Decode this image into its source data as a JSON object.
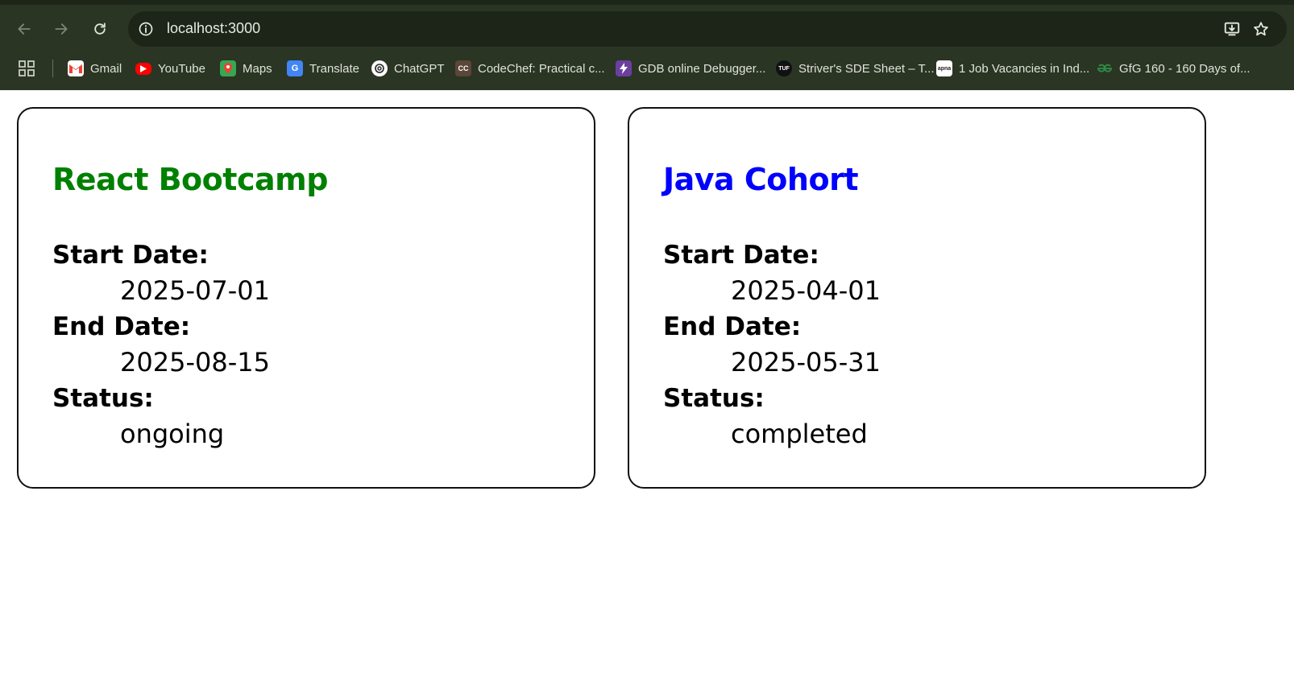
{
  "browser": {
    "url": "localhost:3000",
    "bookmarks": [
      {
        "label": "Gmail",
        "icon": "gmail-icon",
        "color": "#ea4335"
      },
      {
        "label": "YouTube",
        "icon": "youtube-icon",
        "color": "#ff0000"
      },
      {
        "label": "Maps",
        "icon": "maps-icon",
        "color": "#34a853"
      },
      {
        "label": "Translate",
        "icon": "translate-icon",
        "color": "#4285f4"
      },
      {
        "label": "ChatGPT",
        "icon": "chatgpt-icon",
        "color": "#ffffff"
      },
      {
        "label": "CodeChef: Practical c...",
        "icon": "codechef-icon",
        "color": "#5b4638",
        "glyph": "CC"
      },
      {
        "label": "GDB online Debugger...",
        "icon": "gdb-icon",
        "color": "#6a3fa0"
      },
      {
        "label": "Striver's SDE Sheet – T...",
        "icon": "tuf-icon",
        "color": "#111111",
        "glyph": "TUF"
      },
      {
        "label": "1 Job Vacancies in Ind...",
        "icon": "apna-icon",
        "color": "#ffffff",
        "glyph": "apna"
      },
      {
        "label": "GfG 160 - 160 Days of...",
        "icon": "gfg-icon",
        "color": "#2f8d46"
      }
    ]
  },
  "cards": [
    {
      "title": "React Bootcamp",
      "title_color": "#008000",
      "start_label": "Start Date:",
      "start_date": "2025-07-01",
      "end_label": "End Date:",
      "end_date": "2025-08-15",
      "status_label": "Status:",
      "status": "ongoing"
    },
    {
      "title": "Java Cohort",
      "title_color": "#0000ff",
      "start_label": "Start Date:",
      "start_date": "2025-04-01",
      "end_label": "End Date:",
      "end_date": "2025-05-31",
      "status_label": "Status:",
      "status": "completed"
    }
  ]
}
